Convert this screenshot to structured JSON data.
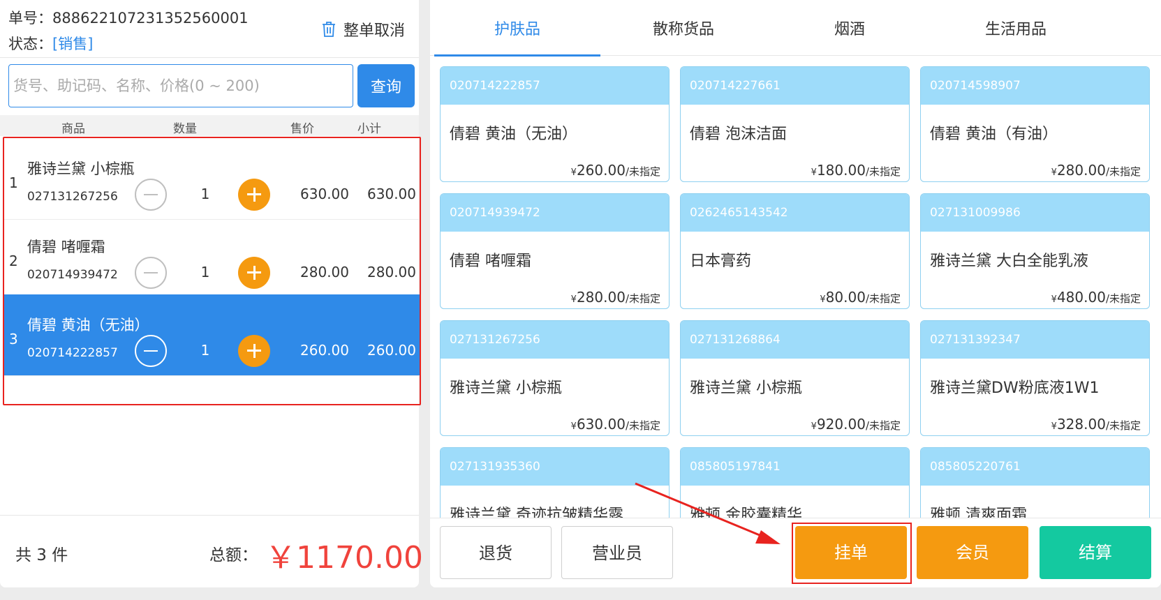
{
  "order": {
    "number_label": "单号：",
    "number": "888622107231352560001",
    "status_label": "状态：",
    "status": "[销售]",
    "cancel_label": "整单取消"
  },
  "search": {
    "placeholder": "货号、助记码、名称、价格(0 ~ 200)",
    "button": "查询"
  },
  "table_headers": {
    "product": "商品",
    "qty": "数量",
    "price": "售价",
    "subtotal": "小计"
  },
  "cart": [
    {
      "index": "1",
      "name": "雅诗兰黛 小棕瓶",
      "code": "027131267256",
      "qty": "1",
      "price": "630.00",
      "subtotal": "630.00"
    },
    {
      "index": "2",
      "name": "倩碧  啫喱霜",
      "code": "020714939472",
      "qty": "1",
      "price": "280.00",
      "subtotal": "280.00"
    },
    {
      "index": "3",
      "name": "倩碧  黄油（无油）",
      "code": "020714222857",
      "qty": "1",
      "price": "260.00",
      "subtotal": "260.00",
      "selected": true
    }
  ],
  "footer": {
    "count": "共 3 件",
    "total_label": "总额：",
    "total": "￥1170.00"
  },
  "tabs": [
    "护肤品",
    "散称货品",
    "烟酒",
    "生活用品"
  ],
  "products": [
    {
      "code": "020714222857",
      "name": "倩碧  黄油（无油）",
      "price": "260.00",
      "unit": "/未指定"
    },
    {
      "code": "020714227661",
      "name": "倩碧  泡沫洁面",
      "price": "180.00",
      "unit": "/未指定"
    },
    {
      "code": "020714598907",
      "name": "倩碧  黄油（有油）",
      "price": "280.00",
      "unit": "/未指定"
    },
    {
      "code": "020714939472",
      "name": "倩碧   啫喱霜",
      "price": "280.00",
      "unit": "/未指定"
    },
    {
      "code": "0262465143542",
      "name": "日本膏药",
      "price": "80.00",
      "unit": "/未指定"
    },
    {
      "code": "027131009986",
      "name": "雅诗兰黛  大白全能乳液",
      "price": "480.00",
      "unit": "/未指定"
    },
    {
      "code": "027131267256",
      "name": "雅诗兰黛 小棕瓶",
      "price": "630.00",
      "unit": "/未指定"
    },
    {
      "code": "027131268864",
      "name": "雅诗兰黛 小棕瓶",
      "price": "920.00",
      "unit": "/未指定"
    },
    {
      "code": "027131392347",
      "name": "雅诗兰黛DW粉底液1W1",
      "price": "328.00",
      "unit": "/未指定"
    },
    {
      "code": "027131935360",
      "name": "雅诗兰黛  奇迹抗皱精华露",
      "price": "",
      "unit": ""
    },
    {
      "code": "085805197841",
      "name": "雅顿  金胶囊精华",
      "price": "",
      "unit": ""
    },
    {
      "code": "085805220761",
      "name": "雅顿  清爽面霜",
      "price": "",
      "unit": ""
    }
  ],
  "currency_symbol": "¥",
  "actions": {
    "return": "退货",
    "clerk": "营业员",
    "hold": "挂单",
    "member": "会员",
    "checkout": "结算"
  },
  "colors": {
    "accent": "#2f8ae8",
    "orange": "#f59a10",
    "green": "#14c9a0",
    "total_red": "#f0433c",
    "highlight": "#e8231f",
    "card_header": "#9edcfa"
  }
}
